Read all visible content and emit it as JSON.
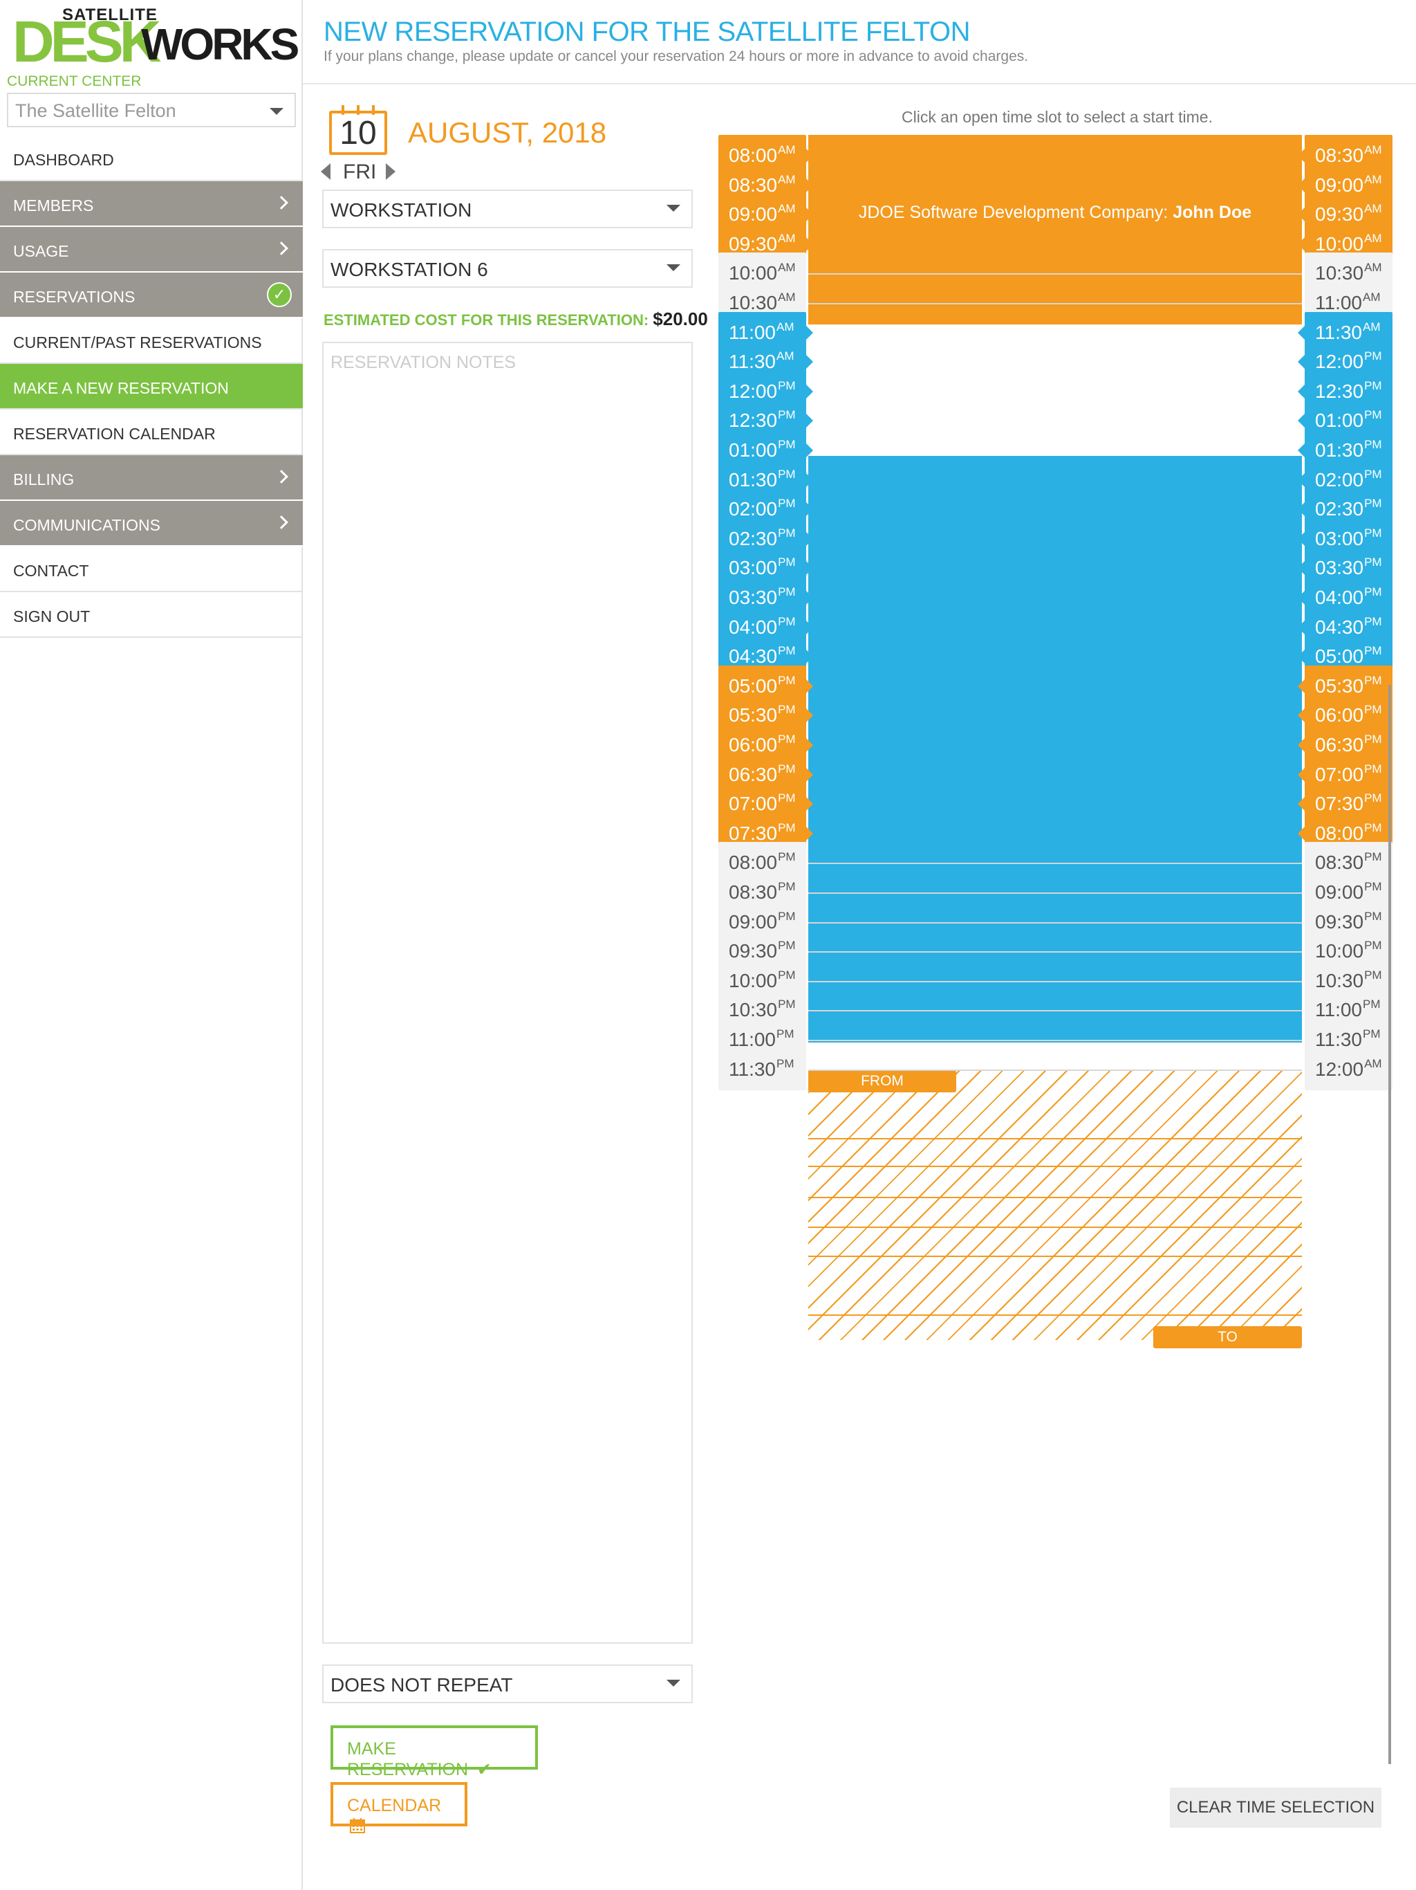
{
  "brand": {
    "top": "SATELLITE",
    "desk": "DESK",
    "works": "WORKS"
  },
  "sidebar": {
    "center_label": "CURRENT CENTER",
    "center_value": "The Satellite Felton",
    "nav": [
      {
        "label": "DASHBOARD",
        "style": "plain"
      },
      {
        "label": "MEMBERS",
        "style": "grey",
        "marker": "chevron"
      },
      {
        "label": "USAGE",
        "style": "grey",
        "marker": "chevron"
      },
      {
        "label": "RESERVATIONS",
        "style": "grey",
        "marker": "check-circle"
      },
      {
        "label": "CURRENT/PAST RESERVATIONS",
        "style": "plain"
      },
      {
        "label": "MAKE A NEW RESERVATION",
        "style": "active"
      },
      {
        "label": "RESERVATION CALENDAR",
        "style": "plain"
      },
      {
        "label": "BILLING",
        "style": "grey",
        "marker": "chevron"
      },
      {
        "label": "COMMUNICATIONS",
        "style": "grey",
        "marker": "chevron"
      },
      {
        "label": "CONTACT",
        "style": "plain"
      },
      {
        "label": "SIGN OUT",
        "style": "plain"
      }
    ]
  },
  "header": {
    "title": "NEW RESERVATION FOR THE SATELLITE FELTON",
    "subtitle": "If your plans change, please update or cancel your reservation 24 hours or more in advance to avoid charges."
  },
  "form": {
    "day_number": "10",
    "month_year": "AUGUST, 2018",
    "weekday": "FRI",
    "resource_type": "WORKSTATION",
    "resource": "WORKSTATION 6",
    "cost_label": "ESTIMATED COST FOR THIS RESERVATION:",
    "cost_value": "$20.00",
    "notes_placeholder": "RESERVATION NOTES",
    "repeat": "DOES NOT REPEAT",
    "make_button": "MAKE RESERVATION",
    "make_icon": "check-icon",
    "calendar_button": "CALENDAR",
    "calendar_icon": "calendar-icon"
  },
  "schedule": {
    "hint": "Click an open time slot to select a start time.",
    "clear_button": "CLEAR TIME SELECTION",
    "booking_label_company": "JDOE Software Development Company:",
    "booking_label_name": "John Doe",
    "from_label": "FROM",
    "to_label": "TO",
    "colors": {
      "booked_orange": "#f39a1f",
      "booked_blue": "#2ab0e3",
      "open": "#f2f2f2",
      "brand_green": "#7cc242"
    },
    "rows": [
      {
        "start": "08:00",
        "start_ap": "AM",
        "end": "08:30",
        "end_ap": "AM",
        "state": "orange"
      },
      {
        "start": "08:30",
        "start_ap": "AM",
        "end": "09:00",
        "end_ap": "AM",
        "state": "orange"
      },
      {
        "start": "09:00",
        "start_ap": "AM",
        "end": "09:30",
        "end_ap": "AM",
        "state": "orange"
      },
      {
        "start": "09:30",
        "start_ap": "AM",
        "end": "10:00",
        "end_ap": "AM",
        "state": "orange"
      },
      {
        "start": "10:00",
        "start_ap": "AM",
        "end": "10:30",
        "end_ap": "AM",
        "state": "open"
      },
      {
        "start": "10:30",
        "start_ap": "AM",
        "end": "11:00",
        "end_ap": "AM",
        "state": "open"
      },
      {
        "start": "11:00",
        "start_ap": "AM",
        "end": "11:30",
        "end_ap": "AM",
        "state": "blue"
      },
      {
        "start": "11:30",
        "start_ap": "AM",
        "end": "12:00",
        "end_ap": "PM",
        "state": "blue"
      },
      {
        "start": "12:00",
        "start_ap": "PM",
        "end": "12:30",
        "end_ap": "PM",
        "state": "blue"
      },
      {
        "start": "12:30",
        "start_ap": "PM",
        "end": "01:00",
        "end_ap": "PM",
        "state": "blue"
      },
      {
        "start": "01:00",
        "start_ap": "PM",
        "end": "01:30",
        "end_ap": "PM",
        "state": "blue"
      },
      {
        "start": "01:30",
        "start_ap": "PM",
        "end": "02:00",
        "end_ap": "PM",
        "state": "blue"
      },
      {
        "start": "02:00",
        "start_ap": "PM",
        "end": "02:30",
        "end_ap": "PM",
        "state": "blue"
      },
      {
        "start": "02:30",
        "start_ap": "PM",
        "end": "03:00",
        "end_ap": "PM",
        "state": "blue"
      },
      {
        "start": "03:00",
        "start_ap": "PM",
        "end": "03:30",
        "end_ap": "PM",
        "state": "blue"
      },
      {
        "start": "03:30",
        "start_ap": "PM",
        "end": "04:00",
        "end_ap": "PM",
        "state": "blue"
      },
      {
        "start": "04:00",
        "start_ap": "PM",
        "end": "04:30",
        "end_ap": "PM",
        "state": "blue"
      },
      {
        "start": "04:30",
        "start_ap": "PM",
        "end": "05:00",
        "end_ap": "PM",
        "state": "blue"
      },
      {
        "start": "05:00",
        "start_ap": "PM",
        "end": "05:30",
        "end_ap": "PM",
        "state": "selected"
      },
      {
        "start": "05:30",
        "start_ap": "PM",
        "end": "06:00",
        "end_ap": "PM",
        "state": "selected"
      },
      {
        "start": "06:00",
        "start_ap": "PM",
        "end": "06:30",
        "end_ap": "PM",
        "state": "selected"
      },
      {
        "start": "06:30",
        "start_ap": "PM",
        "end": "07:00",
        "end_ap": "PM",
        "state": "selected"
      },
      {
        "start": "07:00",
        "start_ap": "PM",
        "end": "07:30",
        "end_ap": "PM",
        "state": "selected"
      },
      {
        "start": "07:30",
        "start_ap": "PM",
        "end": "08:00",
        "end_ap": "PM",
        "state": "selected"
      },
      {
        "start": "08:00",
        "start_ap": "PM",
        "end": "08:30",
        "end_ap": "PM",
        "state": "open"
      },
      {
        "start": "08:30",
        "start_ap": "PM",
        "end": "09:00",
        "end_ap": "PM",
        "state": "open"
      },
      {
        "start": "09:00",
        "start_ap": "PM",
        "end": "09:30",
        "end_ap": "PM",
        "state": "open"
      },
      {
        "start": "09:30",
        "start_ap": "PM",
        "end": "10:00",
        "end_ap": "PM",
        "state": "open"
      },
      {
        "start": "10:00",
        "start_ap": "PM",
        "end": "10:30",
        "end_ap": "PM",
        "state": "open"
      },
      {
        "start": "10:30",
        "start_ap": "PM",
        "end": "11:00",
        "end_ap": "PM",
        "state": "open"
      },
      {
        "start": "11:00",
        "start_ap": "PM",
        "end": "11:30",
        "end_ap": "PM",
        "state": "open"
      },
      {
        "start": "11:30",
        "start_ap": "PM",
        "end": "12:00",
        "end_ap": "AM",
        "state": "open"
      }
    ]
  }
}
